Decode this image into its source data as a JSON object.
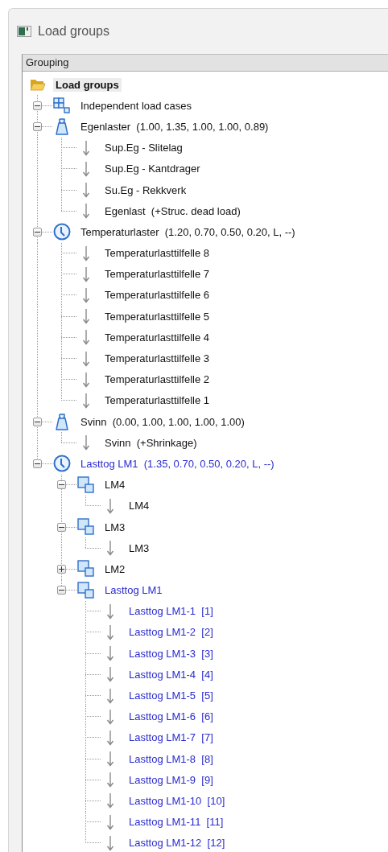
{
  "window": {
    "title": "Load groups"
  },
  "panel": {
    "header": "Grouping",
    "tree": {
      "kind": "folder",
      "label": "Load groups",
      "selected": true,
      "highlighted": false,
      "children": [
        {
          "kind": "independent",
          "label": "Independent load cases",
          "selected": false,
          "highlighted": false,
          "expanded": true
        },
        {
          "kind": "weight",
          "label": "Egenlaster  (1.00, 1.35, 1.00, 1.00, 0.89)",
          "selected": false,
          "highlighted": false,
          "expanded": true,
          "children": [
            {
              "kind": "load",
              "label": "Sup.Eg - Slitelag",
              "selected": false,
              "highlighted": false
            },
            {
              "kind": "load",
              "label": "Sup.Eg - Kantdrager",
              "selected": false,
              "highlighted": false
            },
            {
              "kind": "load",
              "label": "Su.Eg - Rekkverk",
              "selected": false,
              "highlighted": false
            },
            {
              "kind": "load",
              "label": "Egenlast  (+Struc. dead load)",
              "selected": false,
              "highlighted": false
            }
          ]
        },
        {
          "kind": "clock",
          "label": "Temperaturlaster  (1.20, 0.70, 0.50, 0.20, L, --)",
          "selected": false,
          "highlighted": false,
          "expanded": true,
          "children": [
            {
              "kind": "load",
              "label": "Temperaturlasttilfelle 8",
              "selected": false,
              "highlighted": false
            },
            {
              "kind": "load",
              "label": "Temperaturlasttilfelle 7",
              "selected": false,
              "highlighted": false
            },
            {
              "kind": "load",
              "label": "Temperaturlasttilfelle 6",
              "selected": false,
              "highlighted": false
            },
            {
              "kind": "load",
              "label": "Temperaturlasttilfelle 5",
              "selected": false,
              "highlighted": false
            },
            {
              "kind": "load",
              "label": "Temperaturlasttilfelle 4",
              "selected": false,
              "highlighted": false
            },
            {
              "kind": "load",
              "label": "Temperaturlasttilfelle 3",
              "selected": false,
              "highlighted": false
            },
            {
              "kind": "load",
              "label": "Temperaturlasttilfelle 2",
              "selected": false,
              "highlighted": false
            },
            {
              "kind": "load",
              "label": "Temperaturlasttilfelle 1",
              "selected": false,
              "highlighted": false
            }
          ]
        },
        {
          "kind": "weight",
          "label": "Svinn  (0.00, 1.00, 1.00, 1.00, 1.00)",
          "selected": false,
          "highlighted": false,
          "expanded": true,
          "children": [
            {
              "kind": "load",
              "label": "Svinn  (+Shrinkage)",
              "selected": false,
              "highlighted": false
            }
          ]
        },
        {
          "kind": "clock",
          "label": "Lasttog LM1  (1.35, 0.70, 0.50, 0.20, L, --)",
          "selected": false,
          "highlighted": true,
          "expanded": true,
          "children": [
            {
              "kind": "subgroup",
              "label": "LM4",
              "selected": false,
              "highlighted": false,
              "expanded": true,
              "children": [
                {
                  "kind": "load",
                  "label": "LM4",
                  "selected": false,
                  "highlighted": false
                }
              ]
            },
            {
              "kind": "subgroup",
              "label": "LM3",
              "selected": false,
              "highlighted": false,
              "expanded": true,
              "children": [
                {
                  "kind": "load",
                  "label": "LM3",
                  "selected": false,
                  "highlighted": false
                }
              ]
            },
            {
              "kind": "subgroup",
              "label": "LM2",
              "selected": false,
              "highlighted": false,
              "expanded": false
            },
            {
              "kind": "subgroup",
              "label": "Lasttog LM1",
              "selected": false,
              "highlighted": true,
              "expanded": true,
              "children": [
                {
                  "kind": "load",
                  "label": "Lasttog LM1-1  [1]",
                  "selected": false,
                  "highlighted": true
                },
                {
                  "kind": "load",
                  "label": "Lasttog LM1-2  [2]",
                  "selected": false,
                  "highlighted": true
                },
                {
                  "kind": "load",
                  "label": "Lasttog LM1-3  [3]",
                  "selected": false,
                  "highlighted": true
                },
                {
                  "kind": "load",
                  "label": "Lasttog LM1-4  [4]",
                  "selected": false,
                  "highlighted": true
                },
                {
                  "kind": "load",
                  "label": "Lasttog LM1-5  [5]",
                  "selected": false,
                  "highlighted": true
                },
                {
                  "kind": "load",
                  "label": "Lasttog LM1-6  [6]",
                  "selected": false,
                  "highlighted": true
                },
                {
                  "kind": "load",
                  "label": "Lasttog LM1-7  [7]",
                  "selected": false,
                  "highlighted": true
                },
                {
                  "kind": "load",
                  "label": "Lasttog LM1-8  [8]",
                  "selected": false,
                  "highlighted": true
                },
                {
                  "kind": "load",
                  "label": "Lasttog LM1-9  [9]",
                  "selected": false,
                  "highlighted": true
                },
                {
                  "kind": "load",
                  "label": "Lasttog LM1-10  [10]",
                  "selected": false,
                  "highlighted": true
                },
                {
                  "kind": "load",
                  "label": "Lasttog LM1-11  [11]",
                  "selected": false,
                  "highlighted": true
                },
                {
                  "kind": "load",
                  "label": "Lasttog LM1-12  [12]",
                  "selected": false,
                  "highlighted": true
                }
              ]
            }
          ]
        }
      ]
    }
  }
}
